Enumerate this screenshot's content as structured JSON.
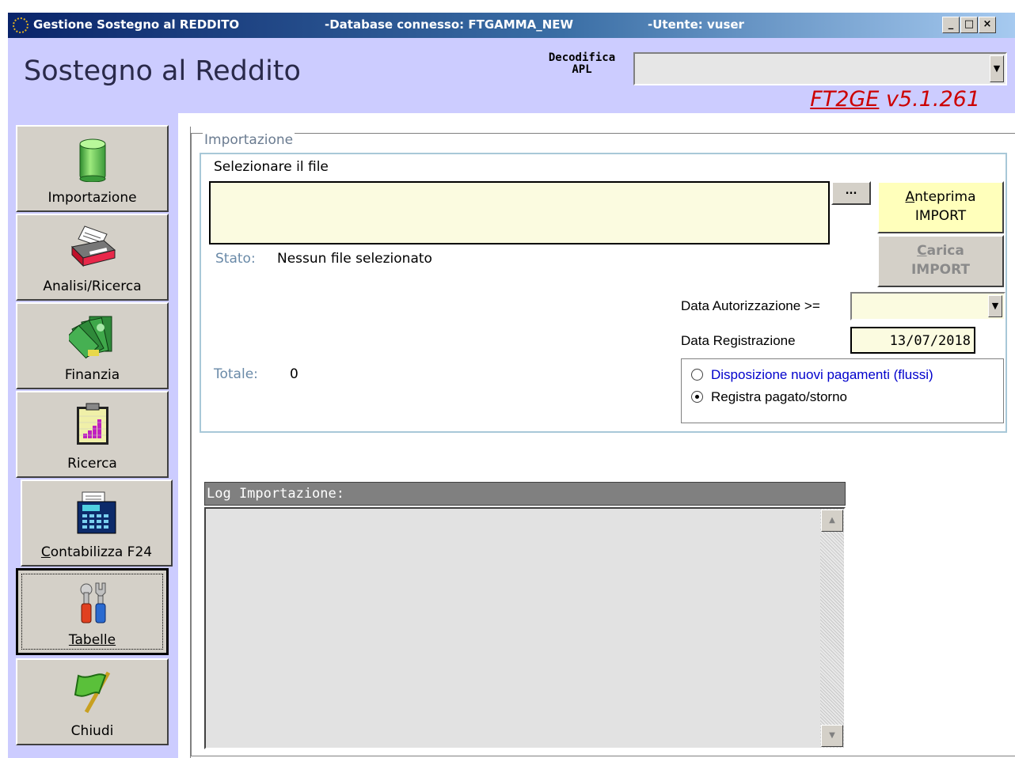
{
  "window": {
    "title_app": "Gestione Sostegno al REDDITO",
    "title_db": "-Database connesso: FTGAMMA_NEW",
    "title_user": "-Utente: vuser",
    "min": "_",
    "max": "□",
    "close": "×"
  },
  "header": {
    "title": "Sostegno al Reddito",
    "decodifica_line1": "Decodifica",
    "decodifica_line2": "APL",
    "apl_value": "",
    "version_prefix": "FT2GE",
    "version_rest": " v5.1.261"
  },
  "sidebar": {
    "items": [
      {
        "label": "Importazione",
        "icon": "database-cylinder-icon"
      },
      {
        "label": "Analisi/Ricerca",
        "icon": "printer-icon"
      },
      {
        "label": "Finanzia",
        "icon": "money-notes-icon"
      },
      {
        "label": "Ricerca",
        "icon": "chart-clipboard-icon"
      },
      {
        "label_underline": "C",
        "label_rest": "ontabilizza F24",
        "icon": "calculator-icon"
      },
      {
        "label": "Tabelle",
        "icon": "tools-icon"
      },
      {
        "label": "Chiudi",
        "icon": "green-flag-icon"
      }
    ]
  },
  "import": {
    "legend": "Importazione",
    "file_label": "Selezionare il file",
    "file_value": "",
    "browse": "...",
    "anteprima_line1_u": "A",
    "anteprima_line1_rest": "nteprima",
    "anteprima_line2": "IMPORT",
    "carica_line1_u": "C",
    "carica_line1_rest": "arica",
    "carica_line2": "IMPORT",
    "stato_label": "Stato:",
    "stato_value": "Nessun file selezionato",
    "totale_label": "Totale:",
    "totale_value": "0",
    "data_aut_label": "Data Autorizzazione >=",
    "data_aut_value": "",
    "data_reg_label": "Data Registrazione",
    "data_reg_value": "13/07/2018",
    "radio_1": "Disposizione nuovi pagamenti (flussi)",
    "radio_2": "Registra pagato/storno",
    "selected_radio": 2
  },
  "log": {
    "header": "Log Importazione:",
    "content": ""
  },
  "colors": {
    "header_bg": "#ccccff",
    "version": "#cc0000",
    "input_bg": "#fbfbe0",
    "anteprima_bg": "#ffffbb",
    "radio_1_text": "#0000cc"
  }
}
